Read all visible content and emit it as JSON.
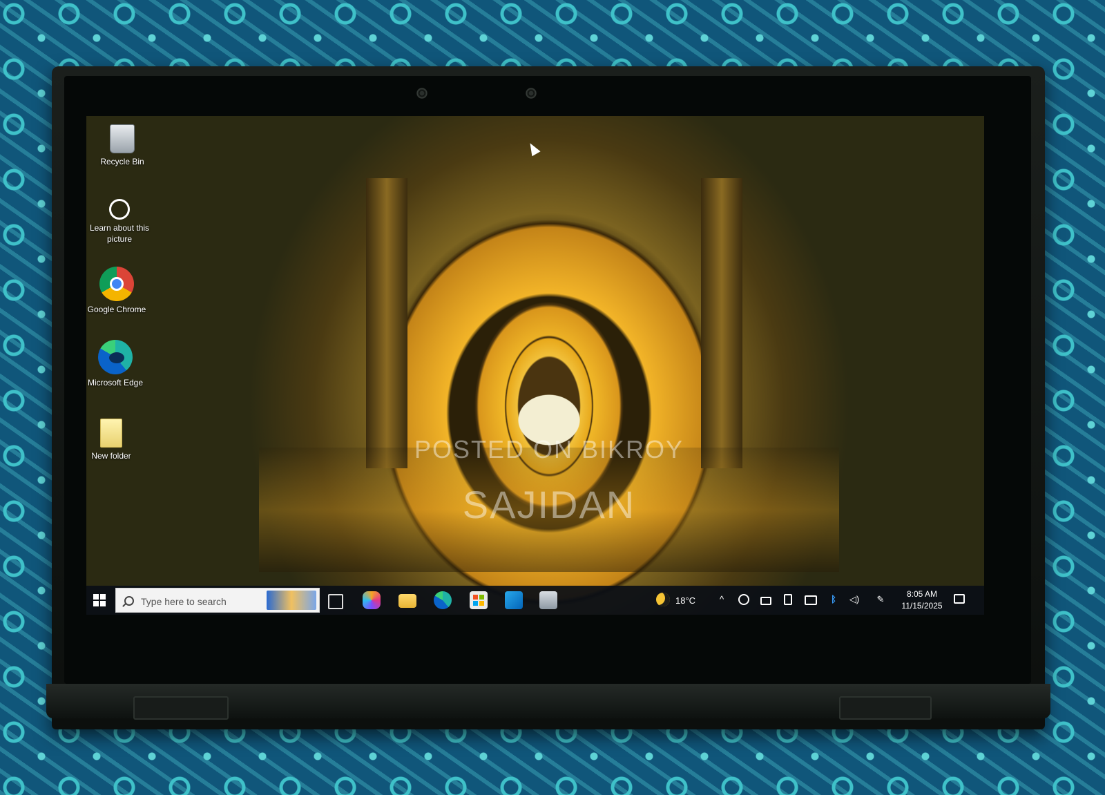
{
  "desktop": {
    "icons": [
      {
        "label": "Recycle Bin"
      },
      {
        "label": "Learn about this picture"
      },
      {
        "label": "Google Chrome"
      },
      {
        "label": "Microsoft Edge"
      },
      {
        "label": "New folder"
      }
    ]
  },
  "watermark": {
    "line1": "POSTED ON BIKROY",
    "line2": "SAJIDAN"
  },
  "taskbar": {
    "search_placeholder": "Type here to search",
    "weather": {
      "icon": "moon-icon",
      "temperature": "18°C"
    },
    "clock": {
      "time": "8:05 AM",
      "date": "11/15/2025"
    },
    "apps": [
      "task-view-icon",
      "copilot-icon",
      "file-explorer-icon",
      "edge-icon",
      "microsoft-store-icon",
      "outlook-icon",
      "app-icon"
    ],
    "tray": [
      "chevron-up-icon",
      "globe-icon",
      "battery-icon",
      "phone-link-icon",
      "screen-icon",
      "bluetooth-icon",
      "volume-icon",
      "pen-icon"
    ]
  },
  "colors": {
    "fabric": "#10567a",
    "fabric_pattern": "#3fc1c9",
    "taskbar": "#0a0e16",
    "accent_yellow": "#f1c03a"
  }
}
